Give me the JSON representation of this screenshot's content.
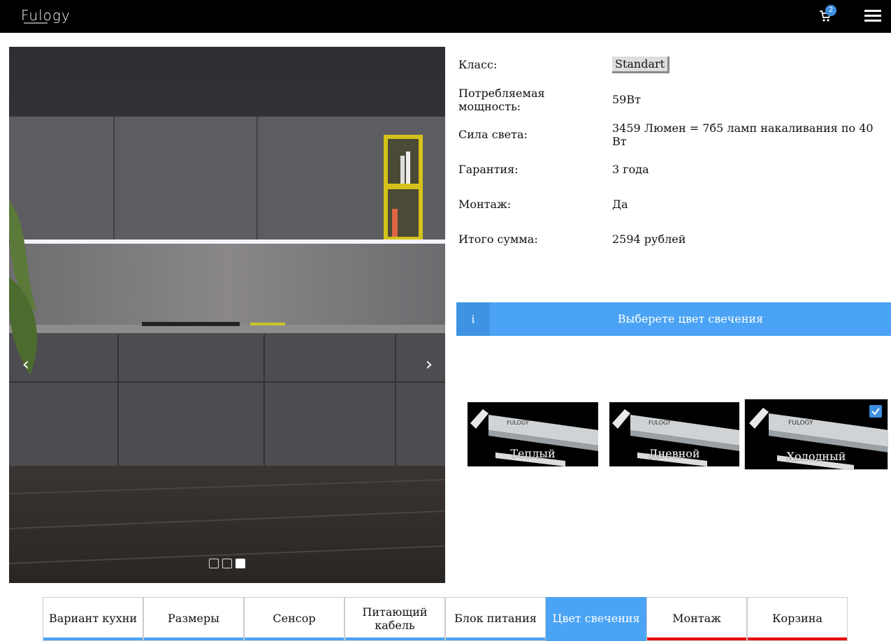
{
  "header": {
    "logo": "Fulogy",
    "cart_count": "2",
    "colors": {
      "background": "#000000",
      "badge": "#3d8fe0"
    }
  },
  "slider": {
    "prev_arrow": "‹",
    "next_arrow": "›",
    "slides_count": 3,
    "active_slide": 3
  },
  "specs": {
    "class_label": "Класс:",
    "class_value": "Standart",
    "power_label": "Потребляемая мощность:",
    "power_value": "59Вт",
    "light_label": "Сила света:",
    "light_value": "3459 Люмен = 7б5 ламп накаливания по 40 Вт",
    "warranty_label": "Гарантия:",
    "warranty_value": "3 года",
    "install_label": "Монтаж:",
    "install_value": "Да",
    "total_label": "Итого сумма:",
    "total_value": "2594 рублей"
  },
  "info_bar": {
    "icon": "i",
    "text": "Выберете цвет свечения",
    "color": "#4aa3f4"
  },
  "color_options": [
    {
      "label": "Теплый",
      "selected": false
    },
    {
      "label": "Дневной",
      "selected": false
    },
    {
      "label": "Холодный",
      "selected": true
    }
  ],
  "tabs": [
    {
      "label": "Вариант кухни",
      "state": "done"
    },
    {
      "label": "Размеры",
      "state": "done"
    },
    {
      "label": "Сенсор",
      "state": "done"
    },
    {
      "label": "Питающий кабель",
      "state": "done"
    },
    {
      "label": "Блок питания",
      "state": "done"
    },
    {
      "label": "Цвет свечения",
      "state": "active"
    },
    {
      "label": "Монтаж",
      "state": "pending"
    },
    {
      "label": "Корзина",
      "state": "pending"
    }
  ],
  "tab_colors": {
    "done": "#4aa3f4",
    "pending": "#e60000"
  }
}
